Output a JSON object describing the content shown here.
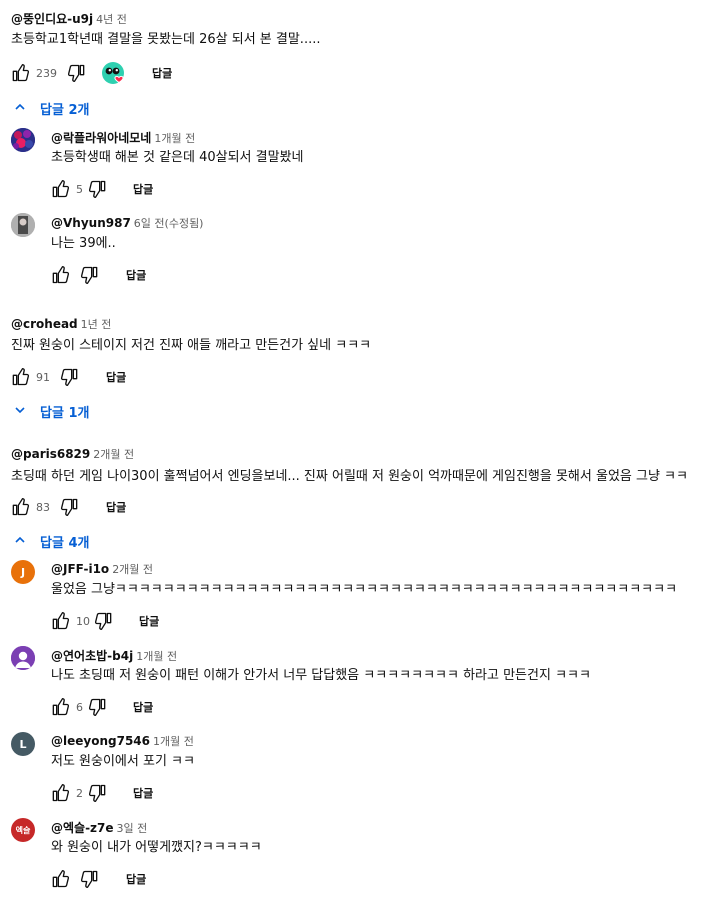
{
  "comments": {
    "c1": {
      "author": "@뚱인디요-u9j",
      "time": "4년 전",
      "text": "초등학교1학년때 결말을 못봤는데 26살 되서 본 결말.....",
      "likes": "239",
      "reply_label": "답글",
      "toggle": "답글 2개"
    },
    "r1": {
      "author": "@락플라워아네모네",
      "time": "1개월 전",
      "text": "초등학생때 해본 것 같은데 40살되서 결말봤네",
      "likes": "5",
      "reply_label": "답글"
    },
    "r2": {
      "author": "@Vhyun987",
      "time": "6일 전(수정됨)",
      "text": "나는 39에..",
      "likes": "",
      "reply_label": "답글"
    },
    "c2": {
      "author": "@crohead",
      "time": "1년 전",
      "text": "진짜 원숭이 스테이지 저건 진짜 애들 깨라고 만든건가 싶네 ㅋㅋㅋ",
      "likes": "91",
      "reply_label": "답글",
      "toggle": "답글 1개"
    },
    "c3": {
      "author": "@paris6829",
      "time": "2개월 전",
      "text": "초딩때 하던 게임 나이30이 훌쩍넘어서 엔딩을보네... 진짜 어릴때 저 원숭이 억까때문에 게임진행을 못해서 울었음 그냥 ㅋㅋ",
      "likes": "83",
      "reply_label": "답글",
      "toggle": "답글 4개"
    },
    "r3": {
      "author": "@JFF-i1o",
      "time": "2개월 전",
      "text": "울었음 그냥ㅋㅋㅋㅋㅋㅋㅋㅋㅋㅋㅋㅋㅋㅋㅋㅋㅋㅋㅋㅋㅋㅋㅋㅋㅋㅋㅋㅋㅋㅋㅋㅋㅋㅋㅋㅋㅋㅋㅋㅋㅋㅋㅋㅋㅋㅋㅋ",
      "likes": "10",
      "reply_label": "답글",
      "avatar_letter": "J"
    },
    "r4": {
      "author": "@연어초밥-b4j",
      "time": "1개월 전",
      "text": "나도 초딩때 저 원숭이 패턴 이해가  안가서 너무 답답했음 ㅋㅋㅋㅋㅋㅋㅋㅋ 하라고 만든건지 ㅋㅋㅋ",
      "likes": "6",
      "reply_label": "답글"
    },
    "r5": {
      "author": "@leeyong7546",
      "time": "1개월 전",
      "text": "저도 원숭이에서 포기 ㅋㅋ",
      "likes": "2",
      "reply_label": "답글",
      "avatar_letter": "L"
    },
    "r6": {
      "author": "@엑슬-z7e",
      "time": "3일 전",
      "text": "와 원숭이 내가 어떻게깼지?ㅋㅋㅋㅋㅋ",
      "likes": "",
      "reply_label": "답글",
      "avatar_letter": "엑슬"
    }
  },
  "colors": {
    "link": "#065fd4",
    "muted": "#606060",
    "avatar_j": "#e8710a",
    "avatar_l": "#455a64",
    "avatar_exs": "#c62828",
    "avatar_purple": "#7b3fb3"
  },
  "icons": {
    "like": "thumb-up-icon",
    "dislike": "thumb-down-icon",
    "expand": "chevron-up-icon",
    "collapse": "chevron-down-icon",
    "creator_heart": "creator-heart-icon"
  }
}
